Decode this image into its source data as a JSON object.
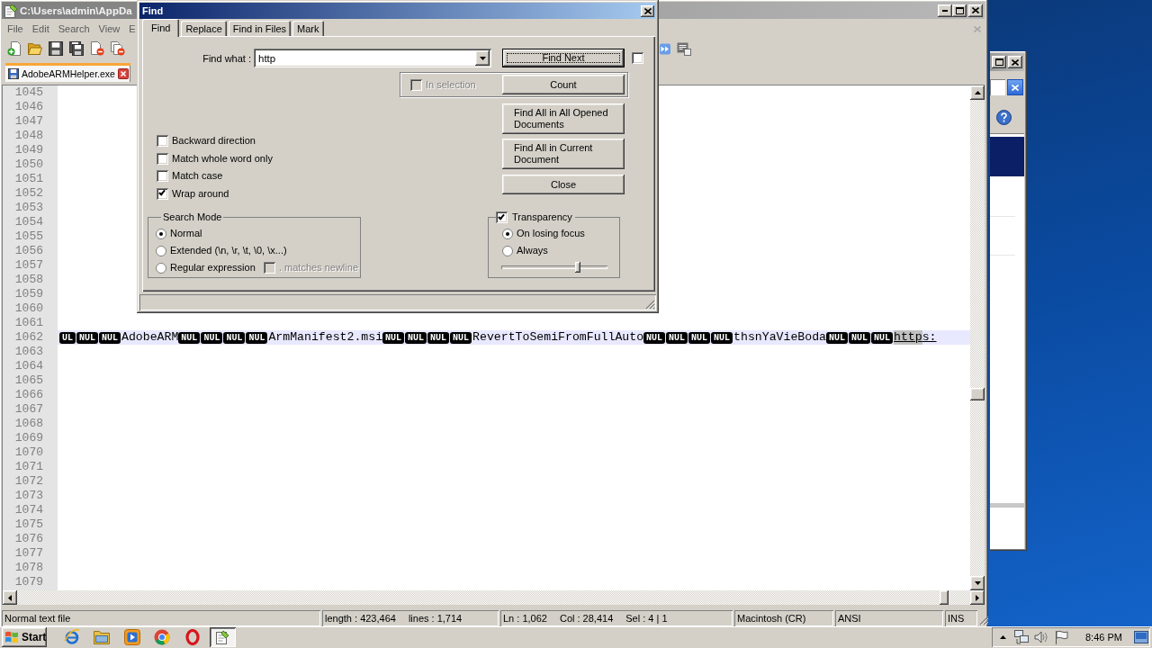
{
  "notepad": {
    "title": "C:\\Users\\admin\\AppDa",
    "menu": [
      "File",
      "Edit",
      "Search",
      "View",
      "E"
    ],
    "tabs": [
      {
        "label": "AdobeARMHelper.exe",
        "selected": true
      }
    ],
    "editor": {
      "lines": [
        {
          "number": "1045",
          "current": false
        },
        {
          "number": "1046",
          "current": false
        },
        {
          "number": "1047",
          "current": false
        },
        {
          "number": "1048",
          "current": false
        },
        {
          "number": "1049",
          "current": false
        },
        {
          "number": "1050",
          "current": false
        },
        {
          "number": "1051",
          "current": false
        },
        {
          "number": "1052",
          "current": false
        },
        {
          "number": "1053",
          "current": false
        },
        {
          "number": "1054",
          "current": false
        },
        {
          "number": "1055",
          "current": false
        },
        {
          "number": "1056",
          "current": false
        },
        {
          "number": "1057",
          "current": false
        },
        {
          "number": "1058",
          "current": false
        },
        {
          "number": "1059",
          "current": false
        },
        {
          "number": "1060",
          "current": false
        },
        {
          "number": "1061",
          "current": false
        },
        {
          "number": "1062",
          "current": true,
          "segments": [
            {
              "kind": "control",
              "text": "UL"
            },
            {
              "kind": "control",
              "text": "NUL"
            },
            {
              "kind": "control",
              "text": "NUL"
            },
            {
              "kind": "text",
              "text": "AdobeARM"
            },
            {
              "kind": "control",
              "text": "NUL"
            },
            {
              "kind": "control",
              "text": "NUL"
            },
            {
              "kind": "control",
              "text": "NUL"
            },
            {
              "kind": "control",
              "text": "NUL"
            },
            {
              "kind": "text",
              "text": "ArmManifest2.msi"
            },
            {
              "kind": "control",
              "text": "NUL"
            },
            {
              "kind": "control",
              "text": "NUL"
            },
            {
              "kind": "control",
              "text": "NUL"
            },
            {
              "kind": "control",
              "text": "NUL"
            },
            {
              "kind": "text",
              "text": "RevertToSemiFromFullAuto"
            },
            {
              "kind": "control",
              "text": "NUL"
            },
            {
              "kind": "control",
              "text": "NUL"
            },
            {
              "kind": "control",
              "text": "NUL"
            },
            {
              "kind": "control",
              "text": "NUL"
            },
            {
              "kind": "text",
              "text": "thsnYaVieBoda"
            },
            {
              "kind": "control",
              "text": "NUL"
            },
            {
              "kind": "control",
              "text": "NUL"
            },
            {
              "kind": "control",
              "text": "NUL"
            },
            {
              "kind": "selected-link",
              "text": "http"
            },
            {
              "kind": "link",
              "text": "s:"
            }
          ]
        },
        {
          "number": "1063",
          "current": false
        },
        {
          "number": "1064",
          "current": false
        },
        {
          "number": "1065",
          "current": false
        },
        {
          "number": "1066",
          "current": false
        },
        {
          "number": "1067",
          "current": false
        },
        {
          "number": "1068",
          "current": false
        },
        {
          "number": "1069",
          "current": false
        },
        {
          "number": "1070",
          "current": false
        },
        {
          "number": "1071",
          "current": false
        },
        {
          "number": "1072",
          "current": false
        },
        {
          "number": "1073",
          "current": false
        },
        {
          "number": "1074",
          "current": false
        },
        {
          "number": "1075",
          "current": false
        },
        {
          "number": "1076",
          "current": false
        },
        {
          "number": "1077",
          "current": false
        },
        {
          "number": "1078",
          "current": false
        },
        {
          "number": "1079",
          "current": false
        }
      ]
    },
    "status_bar": [
      {
        "items": [
          "Normal text file"
        ]
      },
      {
        "items": [
          "length : 423,464",
          "lines : 1,714"
        ]
      },
      {
        "items": [
          "Ln : 1,062",
          "Col : 28,414",
          "Sel : 4 | 1"
        ]
      },
      {
        "items": [
          "Macintosh (CR)"
        ]
      },
      {
        "items": [
          "ANSI"
        ]
      },
      {
        "items": [
          "INS"
        ]
      }
    ]
  },
  "find_dialog": {
    "title": "Find",
    "tabs": [
      {
        "label": "Find",
        "selected": true
      },
      {
        "label": "Replace",
        "selected": false
      },
      {
        "label": "Find in Files",
        "selected": false
      },
      {
        "label": "Mark",
        "selected": false
      }
    ],
    "find_what": {
      "label": "Find what :",
      "value": "http"
    },
    "find_next": {
      "label": "Find Next",
      "focused": true
    },
    "unlabeled_checkbox": {
      "checked": false
    },
    "in_selection": {
      "label": "In selection",
      "checked": false,
      "disabled": true
    },
    "count": {
      "label": "Count"
    },
    "buttons": [
      "Find All in All Opened Documents",
      "Find All in Current Document",
      "Close"
    ],
    "options": [
      {
        "label": "Backward direction",
        "checked": false
      },
      {
        "label": "Match whole word only",
        "checked": false
      },
      {
        "label": "Match case",
        "checked": false
      },
      {
        "label": "Wrap around",
        "checked": true
      }
    ],
    "search_mode": {
      "title": "Search Mode",
      "options": [
        {
          "label": "Normal",
          "selected": true
        },
        {
          "label": "Extended (\\n, \\r, \\t, \\0, \\x...)",
          "selected": false
        },
        {
          "label": "Regular expression",
          "selected": false
        }
      ],
      "dot_matches_newline": {
        "label": ". matches newline",
        "checked": false,
        "disabled": true
      }
    },
    "transparency": {
      "label": "Transparency",
      "checked": true,
      "options": [
        {
          "label": "On losing focus",
          "selected": true
        },
        {
          "label": "Always",
          "selected": false
        }
      ],
      "level": 0.72
    }
  },
  "taskbar": {
    "start": "Start",
    "apps": [
      {
        "kind": "globe",
        "active": false
      },
      {
        "kind": "folder",
        "active": false
      },
      {
        "kind": "player",
        "active": false
      },
      {
        "kind": "wheel",
        "active": false
      },
      {
        "kind": "ring",
        "active": false
      },
      {
        "kind": "notepad",
        "active": true
      }
    ],
    "clock": "8:46 PM"
  }
}
